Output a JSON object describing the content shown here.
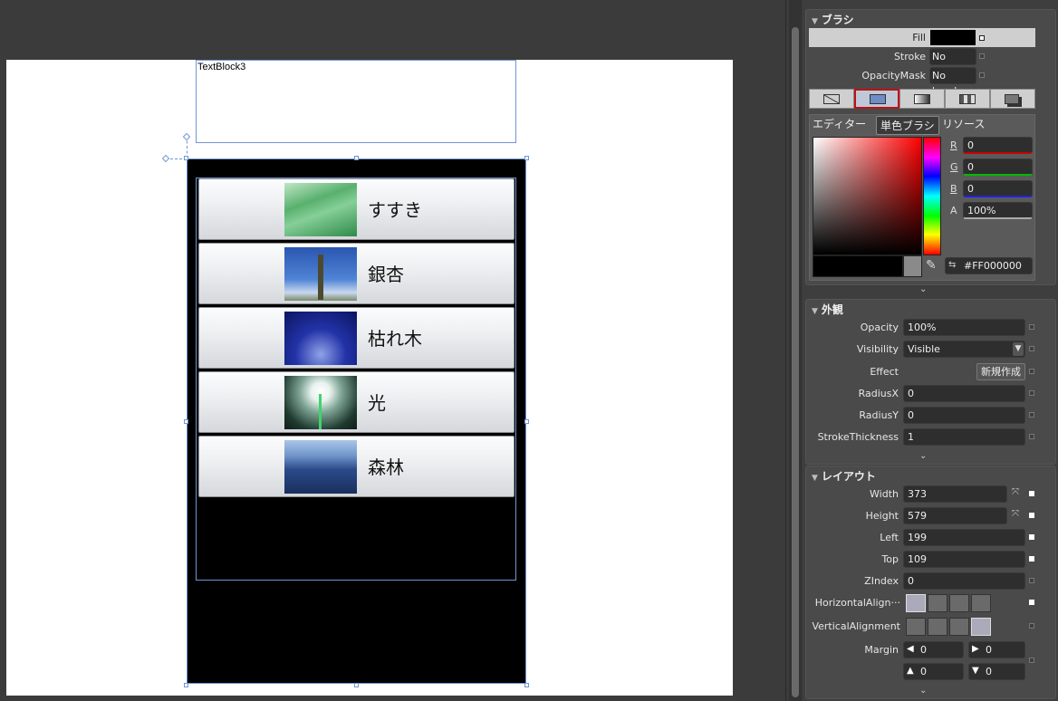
{
  "canvas": {
    "textblock_label": "TextBlock3",
    "list_items": [
      {
        "label": "すすき",
        "thumb": "grass-photo"
      },
      {
        "label": "銀杏",
        "thumb": "ginkgo-photo"
      },
      {
        "label": "枯れ木",
        "thumb": "bare-tree-photo"
      },
      {
        "label": "光",
        "thumb": "light-photo"
      },
      {
        "label": "森林",
        "thumb": "forest-photo"
      }
    ]
  },
  "brush": {
    "section_title": "ブラシ",
    "fill_label": "Fill",
    "stroke_label": "Stroke",
    "stroke_value": "No brush",
    "opacitymask_label": "OpacityMask",
    "opacitymask_value": "No brush",
    "editor_tab": "エディター",
    "resource_tab": "リソース",
    "tooltip": "単色ブラシ",
    "r_label": "R",
    "r_value": "0",
    "g_label": "G",
    "g_value": "0",
    "b_label": "B",
    "b_value": "0",
    "a_label": "A",
    "a_value": "100%",
    "hex_value": "#FF000000",
    "fill_color": "#000000"
  },
  "appearance": {
    "section_title": "外観",
    "opacity_label": "Opacity",
    "opacity_value": "100%",
    "visibility_label": "Visibility",
    "visibility_value": "Visible",
    "effect_label": "Effect",
    "effect_button": "新規作成",
    "radiusx_label": "RadiusX",
    "radiusx_value": "0",
    "radiusy_label": "RadiusY",
    "radiusy_value": "0",
    "stroke_thickness_label": "StrokeThickness",
    "stroke_thickness_value": "1"
  },
  "layout": {
    "section_title": "レイアウト",
    "width_label": "Width",
    "width_value": "373",
    "height_label": "Height",
    "height_value": "579",
    "left_label": "Left",
    "left_value": "199",
    "top_label": "Top",
    "top_value": "109",
    "zindex_label": "ZIndex",
    "zindex_value": "0",
    "halign_label": "HorizontalAlign···",
    "valign_label": "VerticalAlignment",
    "margin_label": "Margin",
    "margin_left": "0",
    "margin_right": "0",
    "margin_top": "0",
    "margin_bottom": "0"
  }
}
